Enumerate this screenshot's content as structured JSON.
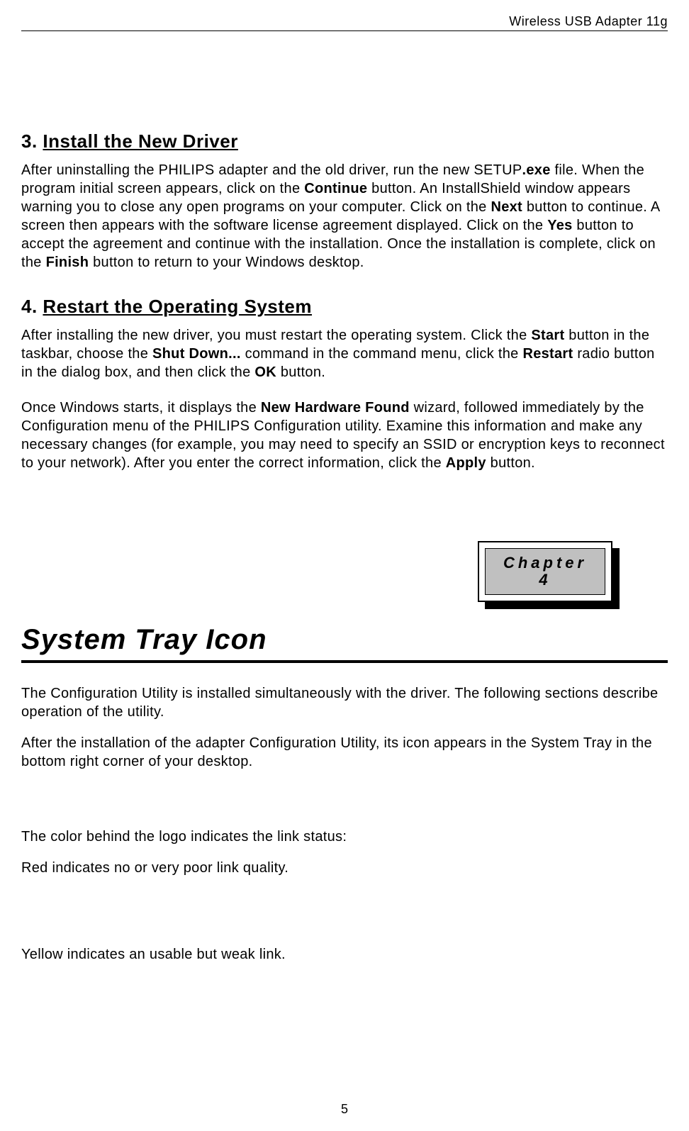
{
  "header": {
    "title": "Wireless USB Adapter 11g"
  },
  "section3": {
    "num": "3.",
    "title": "Install the New Driver",
    "para_html": "After uninstalling the PHILIPS adapter and the old driver, run the new SETUP<b>.exe</b> file. When the program initial screen appears, click on the <b>Continue</b> button. An InstallShield window appears warning you to close any open programs on your computer. Click on the <b>Next</b> button to continue. A screen then appears with the software license agreement displayed. Click on the <b>Yes</b> button to accept the agreement and continue with the installation. Once the installation is complete, click on the <b>Finish</b> button to return to your Windows desktop."
  },
  "section4": {
    "num": "4.",
    "title": "Restart the Operating System",
    "para1_html": "After installing the new driver, you must restart the operating system. Click the <b>Start</b> button in the taskbar, choose the <b>Shut Down...</b> command in the command menu, click the <b>Restart</b> radio button in the dialog box, and then click the <b>OK</b> button.",
    "para2_html": "Once Windows starts, it displays the <b>New Hardware Found</b> wizard, followed immediately by the Configuration menu of the PHILIPS Configuration utility. Examine this information and make any necessary changes (for example, you may need to specify an SSID or encryption keys to reconnect to your network). After you enter the correct information, click the <b>Apply</b> button."
  },
  "chapter_box": {
    "label": "Chapter",
    "num": "4"
  },
  "big_heading": "System Tray Icon",
  "tray": {
    "p1": "The Configuration Utility is installed simultaneously with the driver. The following sections describe operation of the utility.",
    "p2": "After the installation of the adapter Configuration Utility, its icon appears in the System Tray in the bottom right corner of your desktop.",
    "p3": "The color behind the logo indicates the link status:",
    "p4": "Red indicates no or very poor link quality.",
    "p5": "Yellow indicates an usable but weak link."
  },
  "page_number": "5"
}
